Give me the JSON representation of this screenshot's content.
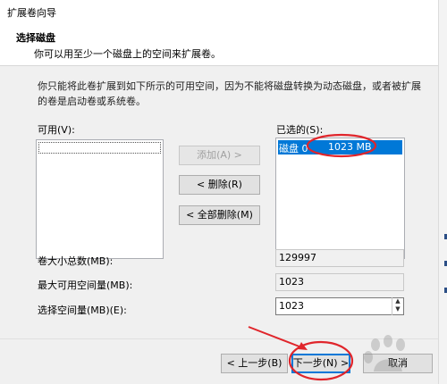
{
  "window": {
    "title": "扩展卷向导"
  },
  "header": {
    "title": "选择磁盘",
    "subtitle": "你可以用至少一个磁盘上的空间来扩展卷。"
  },
  "description": "你只能将此卷扩展到如下所示的可用空间，因为不能将磁盘转换为动态磁盘，或者被扩展的卷是启动卷或系统卷。",
  "available": {
    "label": "可用(V):"
  },
  "selected": {
    "label": "已选的(S):",
    "items": [
      {
        "disk": "磁盘 0",
        "size": "1023 MB"
      }
    ]
  },
  "buttons": {
    "add": "添加(A) >",
    "remove": "< 删除(R)",
    "remove_all": "< 全部删除(M)"
  },
  "fields": {
    "total_label": "卷大小总数(MB):",
    "total_value": "129997",
    "max_label": "最大可用空间量(MB):",
    "max_value": "1023",
    "select_label": "选择空间量(MB)(E):",
    "select_value": "1023"
  },
  "footer": {
    "back": "< 上一步(B)",
    "next": "下一步(N) >",
    "cancel": "取消"
  },
  "colors": {
    "selection": "#0078d7",
    "annotation": "#e0252b",
    "dialog_bg": "#f0f0f0"
  }
}
